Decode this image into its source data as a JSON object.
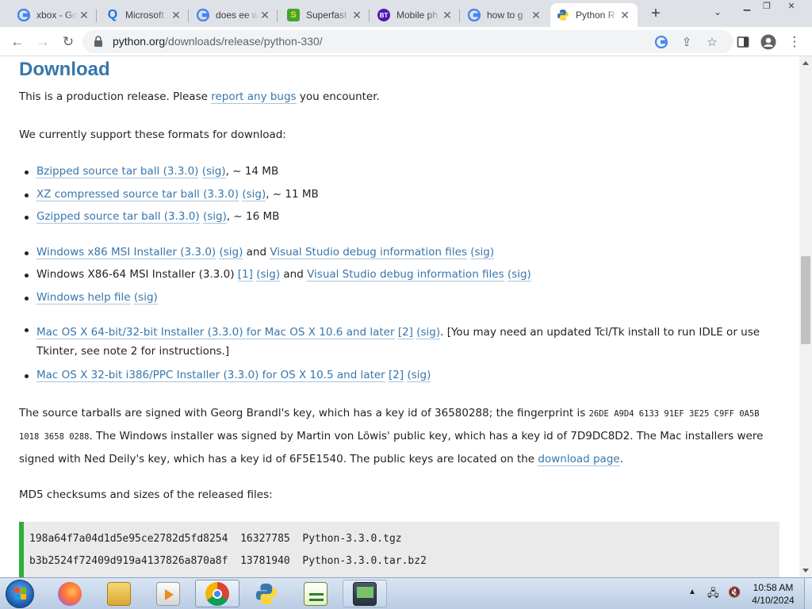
{
  "browser": {
    "tabs": [
      {
        "title": "xbox - Go",
        "favicon": "google-icon"
      },
      {
        "title": "Microsoft",
        "favicon": "bing-icon"
      },
      {
        "title": "does ee w",
        "favicon": "google-icon"
      },
      {
        "title": "Superfast",
        "favicon": "superfast-icon"
      },
      {
        "title": "Mobile ph",
        "favicon": "bt-icon"
      },
      {
        "title": "how to g",
        "favicon": "google-icon"
      },
      {
        "title": "Python R",
        "favicon": "python-icon",
        "active": true
      }
    ],
    "new_tab": "+",
    "url_host": "python.org",
    "url_path": "/downloads/release/python-330/"
  },
  "page": {
    "heading": "Download",
    "intro_pre": "This is a production release. Please ",
    "intro_link": "report any bugs",
    "intro_post": " you encounter.",
    "formats_intro": "We currently support these formats for download:",
    "source_files": [
      {
        "name": "Bzipped source tar ball (3.3.0)",
        "sig": "(sig)",
        "size": ", ~ 14 MB"
      },
      {
        "name": "XZ compressed source tar ball (3.3.0)",
        "sig": "(sig)",
        "size": ", ~ 11 MB"
      },
      {
        "name": "Gzipped source tar ball (3.3.0)",
        "sig": "(sig)",
        "size": ", ~ 16 MB"
      }
    ],
    "win1_link": "Windows x86 MSI Installer (3.3.0)",
    "win1_sig": "(sig)",
    "and": "and",
    "vs_link": "Visual Studio debug information files",
    "vs_sig": "(sig)",
    "win2_text": "Windows X86-64 MSI Installer (3.3.0)",
    "win2_note": "[1]",
    "win2_sig": "(sig)",
    "vs2_link": "Visual Studio debug information files",
    "vs2_sig": "(sig)",
    "help_link": "Windows help file",
    "help_sig": "(sig)",
    "mac1_link": "Mac OS X 64-bit/32-bit Installer (3.3.0) for Mac OS X 10.6 and later",
    "mac1_note": "[2]",
    "mac1_sig": "(sig)",
    "mac1_text": ". [You may need an updated Tcl/Tk install to run IDLE or use Tkinter, see note 2 for instructions.]",
    "mac2_link": "Mac OS X 32-bit i386/PPC Installer (3.3.0) for OS X 10.5 and later",
    "mac2_note": "[2]",
    "mac2_sig": "(sig)",
    "sig_text1": "The source tarballs are signed with Georg Brandl's key, which has a key id of 36580288; the fingerprint is ",
    "fingerprint": "26DE A9D4 6133 91EF 3E25 C9FF 0A5B 1018 3658 0288",
    "sig_text2": ". The Windows installer was signed by Martin von Löwis' public key, which has a key id of 7D9DC8D2. The Mac installers were signed with Ned Deily's key, which has a key id of 6F5E1540. The public keys are located on the ",
    "sig_link": "download page",
    "sig_end": ".",
    "md5_intro": "MD5 checksums and sizes of the released files:",
    "checksums": [
      "198a64f7a04d1d5e95ce2782d5fd8254  16327785  Python-3.3.0.tgz",
      "b3b2524f72409d919a4137826a870a8f  13781940  Python-3.3.0.tar.bz2"
    ]
  },
  "taskbar": {
    "apps": [
      "firefox-icon",
      "file-explorer-icon",
      "media-player-icon",
      "chrome-icon",
      "python-icon",
      "notepad-icon",
      "screen-icon"
    ],
    "clock_time": "10:58 AM",
    "clock_date": "4/10/2024"
  },
  "colors": {
    "link": "#3776ab",
    "heading": "#3776ab",
    "code_border": "#2eaf3b"
  }
}
